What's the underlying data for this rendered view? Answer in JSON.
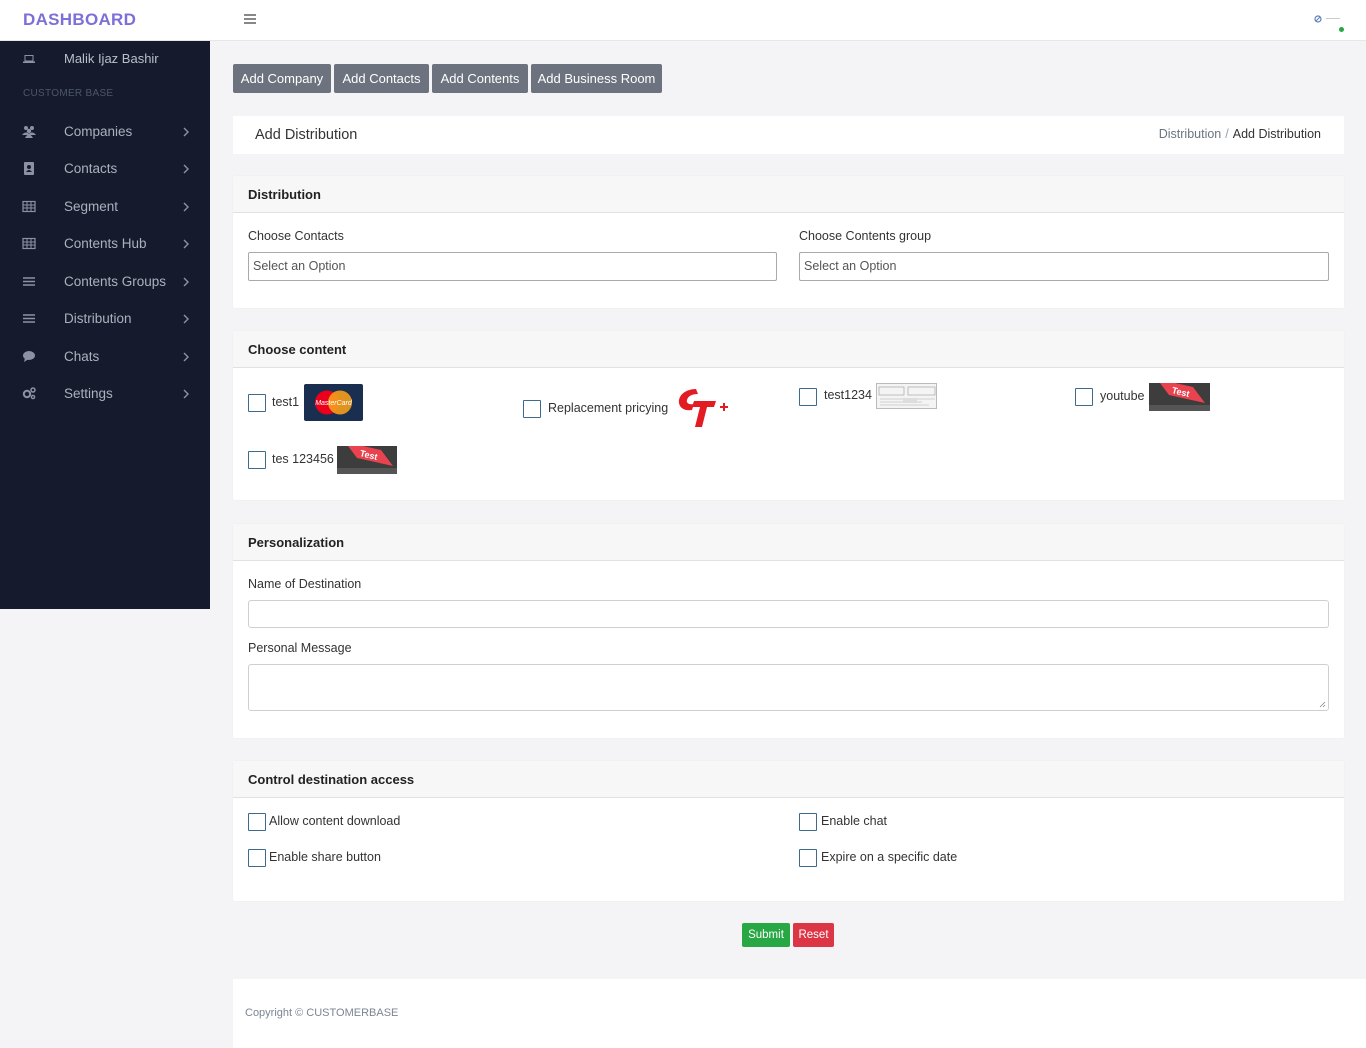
{
  "header": {
    "brand": "DASHBOARD",
    "brand_color": "#7c6fd8",
    "menu_icon": "hamburger-icon",
    "avatar_icon": "user-avatar-icon",
    "status_color": "#28a745"
  },
  "sidebar": {
    "user_name": "Malik Ijaz Bashir",
    "user_icon": "laptop-icon",
    "section_title": "CUSTOMER BASE",
    "items": [
      {
        "label": "Companies",
        "icon": "users-icon"
      },
      {
        "label": "Contacts",
        "icon": "address-book-icon"
      },
      {
        "label": "Segment",
        "icon": "table-icon"
      },
      {
        "label": "Contents Hub",
        "icon": "table-icon"
      },
      {
        "label": "Contents Groups",
        "icon": "list-icon"
      },
      {
        "label": "Distribution",
        "icon": "list-icon"
      },
      {
        "label": "Chats",
        "icon": "comment-icon"
      },
      {
        "label": "Settings",
        "icon": "gears-icon"
      }
    ]
  },
  "toolbar": {
    "buttons": [
      "Add Company",
      "Add Contacts",
      "Add Contents",
      "Add Business Room"
    ]
  },
  "page": {
    "title": "Add Distribution",
    "breadcrumb": {
      "parent": "Distribution",
      "separator": "/",
      "current": "Add Distribution"
    }
  },
  "distribution": {
    "heading": "Distribution",
    "contacts_label": "Choose Contacts",
    "contacts_value": "Select an Option",
    "group_label": "Choose Contents group",
    "group_value": "Select an Option"
  },
  "content": {
    "heading": "Choose content",
    "items": [
      {
        "label": "test1",
        "thumb": "mastercard-logo"
      },
      {
        "label": "Replacement pricying",
        "thumb": "ct-logo"
      },
      {
        "label": "test1234",
        "thumb": "document-thumbnail"
      },
      {
        "label": "youtube",
        "thumb": "test-key-image"
      },
      {
        "label": "tes 123456",
        "thumb": "test-key-image"
      }
    ],
    "mastercard_text": "MasterCard",
    "test_key_text": "Test"
  },
  "personalization": {
    "heading": "Personalization",
    "destination_label": "Name of Destination",
    "destination_value": "",
    "message_label": "Personal Message",
    "message_value": ""
  },
  "access": {
    "heading": "Control destination access",
    "options": [
      "Allow content download",
      "Enable chat",
      "Enable share button",
      "Expire on a specific date"
    ]
  },
  "actions": {
    "submit": "Submit",
    "reset": "Reset",
    "submit_color": "#28a745",
    "reset_color": "#dc3545"
  },
  "footer": {
    "copyright": "Copyright © CUSTOMERBASE"
  }
}
